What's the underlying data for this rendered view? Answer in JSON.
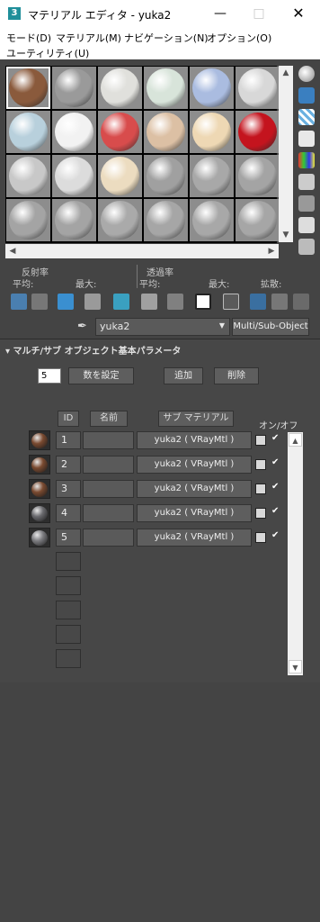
{
  "window": {
    "title": "マテリアル エディタ - yuka2",
    "app_icon": "3"
  },
  "menu": {
    "items": [
      "モード(D)",
      "マテリアル(M)",
      "ナビゲーション(N)",
      "オプション(O)",
      "ユーティリティ(U)"
    ]
  },
  "slots": [
    {
      "color": "#8a5a3c",
      "selected": true
    },
    {
      "color": "#9a9a9a"
    },
    {
      "color": "#e0e0dc"
    },
    {
      "color": "#d8e4da"
    },
    {
      "color": "#aabce0"
    },
    {
      "color": "#d8d8d8"
    },
    {
      "color": "#b8d0dc"
    },
    {
      "color": "#f2f2f2"
    },
    {
      "color": "#d84c4c"
    },
    {
      "color": "#dcc0a4"
    },
    {
      "color": "#eed8b4"
    },
    {
      "color": "#c4141e"
    },
    {
      "color": "#c8c8c8"
    },
    {
      "color": "#dcdcdc"
    },
    {
      "color": "#ecdcc0"
    },
    {
      "color": "#a0a0a0"
    },
    {
      "color": "#a8a8a8"
    },
    {
      "color": "#a4a4a4"
    },
    {
      "color": "#a4a4a4"
    },
    {
      "color": "#a4a4a4"
    },
    {
      "color": "#aaaaaa"
    },
    {
      "color": "#a6a6a6"
    },
    {
      "color": "#a8a8a8"
    },
    {
      "color": "#a6a6a6"
    }
  ],
  "stats": {
    "reflectance": "反射率",
    "transmittance": "透過率",
    "avg1": "平均:",
    "max1": "最大:",
    "avg2": "平均:",
    "max2": "最大:",
    "diffuse": "拡散:"
  },
  "material": {
    "name": "yuka2",
    "type": "Multi/Sub-Object"
  },
  "rollout": {
    "title": "マルチ/サブ オブジェクト基本パラメータ",
    "count": "5",
    "set_count": "数を設定",
    "add": "追加",
    "delete": "削除",
    "col_id": "ID",
    "col_name": "名前",
    "col_sub": "サブ マテリアル",
    "col_onoff": "オン/オフ"
  },
  "rows": [
    {
      "id": "1",
      "sub": "yuka2 ( VRayMtl )",
      "checked": "✔",
      "swatch": "#7a4a30"
    },
    {
      "id": "2",
      "sub": "yuka2 ( VRayMtl )",
      "checked": "✔",
      "swatch": "#7a4a30"
    },
    {
      "id": "3",
      "sub": "yuka2 ( VRayMtl )",
      "checked": "✔",
      "swatch": "#7a4a30"
    },
    {
      "id": "4",
      "sub": "yuka2 ( VRayMtl )",
      "checked": "✔",
      "swatch": "#6a6a6e"
    },
    {
      "id": "5",
      "sub": "yuka2 ( VRayMtl )",
      "checked": "✔",
      "swatch": "#7c7c80"
    }
  ]
}
